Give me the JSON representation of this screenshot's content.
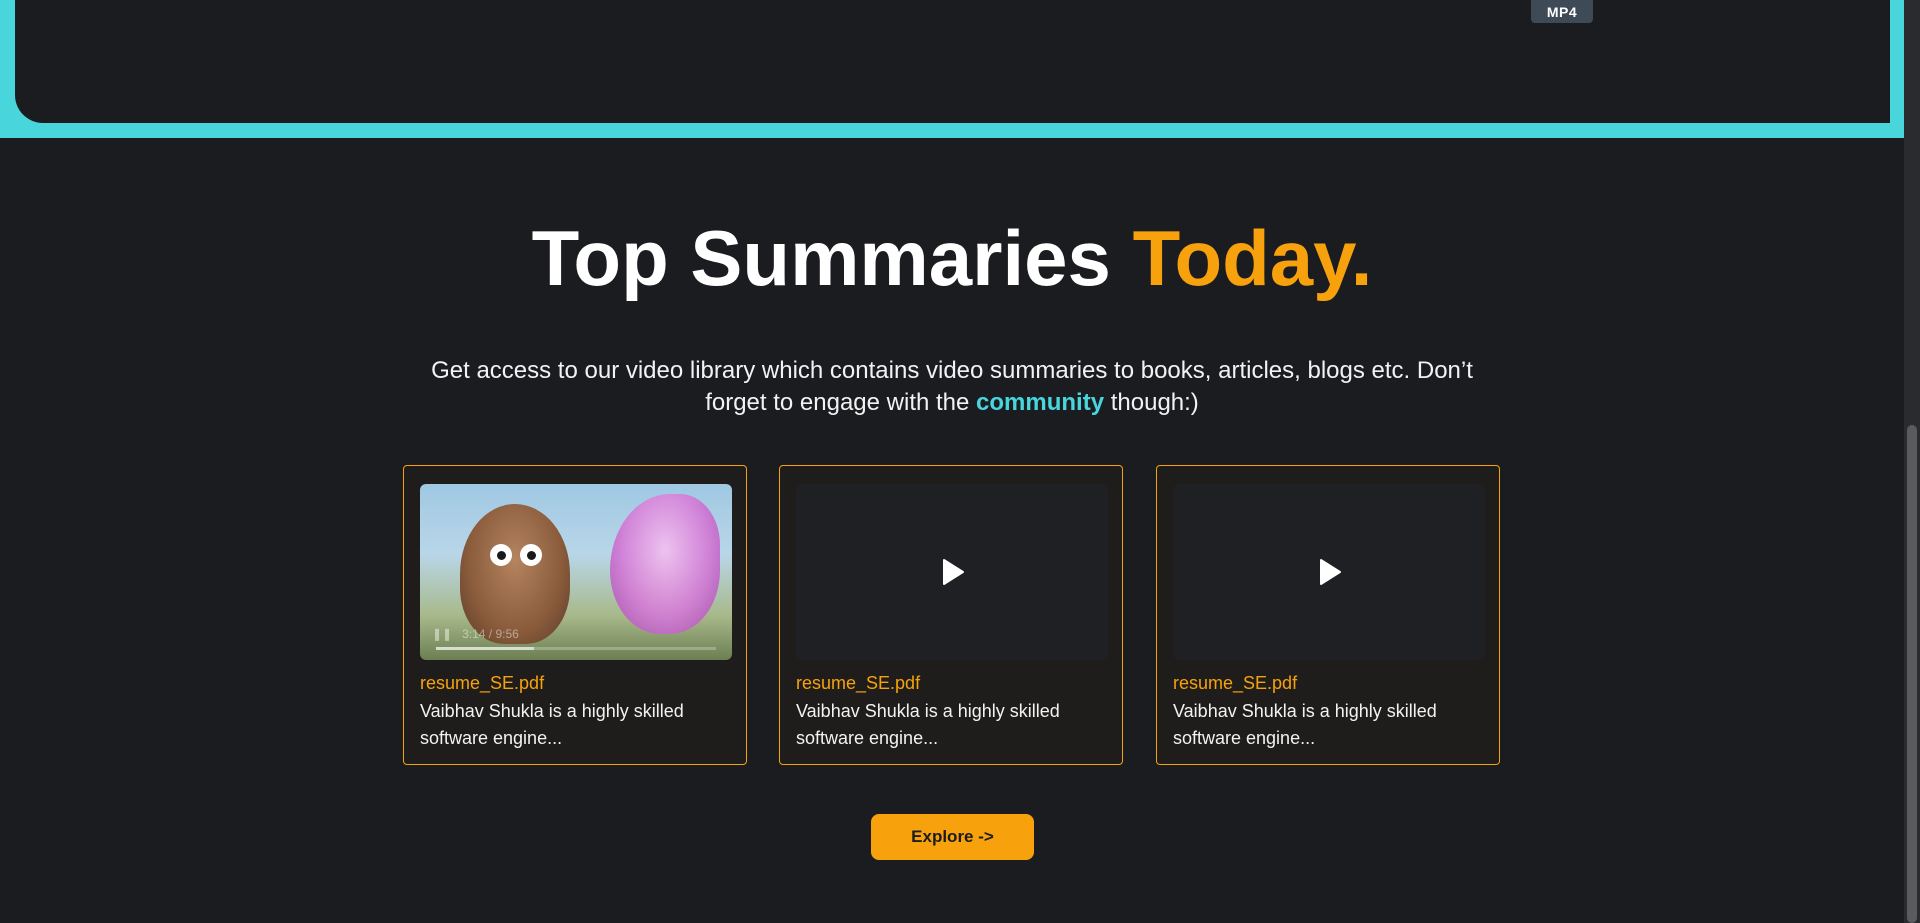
{
  "top_panel": {
    "format_badge": "MP4"
  },
  "section": {
    "title_main": "Top Summaries ",
    "title_accent": "Today.",
    "desc_before": "Get access to our video library which contains video summaries to books, articles, blogs etc. Don’t forget to engage with the ",
    "desc_link": "community",
    "desc_after": " though:)"
  },
  "cards": [
    {
      "title": "resume_SE.pdf",
      "description": "Vaibhav Shukla is a highly skilled software engine...",
      "video_state": "playing",
      "time_readout": "3:14 / 9:56",
      "progress": 0.35
    },
    {
      "title": "resume_SE.pdf",
      "description": "Vaibhav Shukla is a highly skilled software engine...",
      "video_state": "paused"
    },
    {
      "title": "resume_SE.pdf",
      "description": "Vaibhav Shukla is a highly skilled software engine...",
      "video_state": "paused"
    }
  ],
  "explore_button": "Explore ->",
  "colors": {
    "accent_orange": "#f7a10d",
    "accent_cyan": "#48d5dc",
    "background": "#1b1c20"
  }
}
